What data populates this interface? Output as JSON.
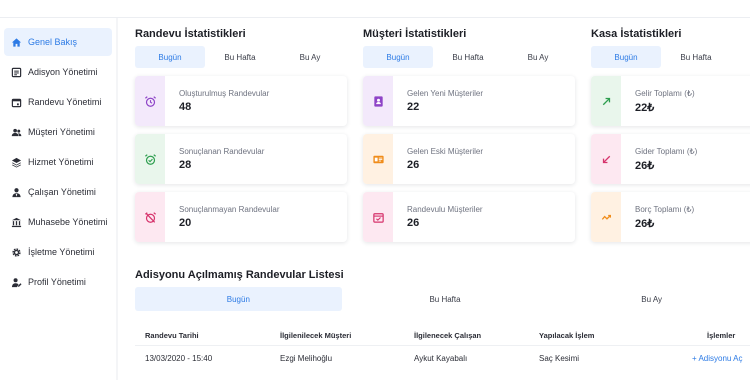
{
  "sidebar": {
    "items": [
      {
        "label": "Genel Bakış",
        "icon": "home-icon",
        "active": true
      },
      {
        "label": "Adisyon Yönetimi",
        "icon": "receipt-icon"
      },
      {
        "label": "Randevu Yönetimi",
        "icon": "calendar-icon"
      },
      {
        "label": "Müşteri Yönetimi",
        "icon": "users-icon"
      },
      {
        "label": "Hizmet Yönetimi",
        "icon": "layers-icon"
      },
      {
        "label": "Çalışan Yönetimi",
        "icon": "user-tie-icon"
      },
      {
        "label": "Muhasebe Yönetimi",
        "icon": "bank-icon"
      },
      {
        "label": "İşletme Yönetimi",
        "icon": "gear-icon"
      },
      {
        "label": "Profil Yönetimi",
        "icon": "profile-icon"
      }
    ]
  },
  "appointments": {
    "title": "Randevu İstatistikleri",
    "tabs": [
      "Bugün",
      "Bu Hafta",
      "Bu Ay"
    ],
    "cards": [
      {
        "label": "Oluşturulmuş Randevular",
        "value": "48"
      },
      {
        "label": "Sonuçlanan Randevular",
        "value": "28"
      },
      {
        "label": "Sonuçlanmayan Randevular",
        "value": "20"
      }
    ]
  },
  "customers": {
    "title": "Müşteri İstatistikleri",
    "tabs": [
      "Bugün",
      "Bu Hafta",
      "Bu Ay"
    ],
    "cards": [
      {
        "label": "Gelen Yeni Müşteriler",
        "value": "22"
      },
      {
        "label": "Gelen Eski Müşteriler",
        "value": "26"
      },
      {
        "label": "Randevulu Müşteriler",
        "value": "26"
      }
    ]
  },
  "cash": {
    "title": "Kasa İstatistikleri",
    "tabs": [
      "Bugün",
      "Bu Hafta"
    ],
    "cards": [
      {
        "label": "Gelir Toplamı (₺)",
        "value": "22₺"
      },
      {
        "label": "Gider Toplamı (₺)",
        "value": "26₺"
      },
      {
        "label": "Borç Toplamı (₺)",
        "value": "26₺"
      }
    ]
  },
  "unbilled": {
    "title": "Adisyonu Açılmamış Randevular Listesi",
    "tabs": [
      "Bugün",
      "Bu Hafta",
      "Bu Ay"
    ],
    "columns": [
      "Randevu Tarihi",
      "İlgilenilecek Müşteri",
      "İlgilenecek Çalışan",
      "Yapılacak İşlem",
      "İşlemler"
    ],
    "rows": [
      {
        "date": "13/03/2020 - 15:40",
        "customer": "Ezgi Melihoğlu",
        "employee": "Aykut Kayabalı",
        "service": "Saç Kesimi",
        "action": "+ Adisyonu Aç"
      }
    ]
  },
  "colors": {
    "accent": "#2d7be5",
    "purple_bg": "#f3e9fb",
    "purple": "#8e44c7",
    "green_bg": "#e9f6ec",
    "green": "#2e9e4f",
    "pink_bg": "#fde8f1",
    "pink": "#d6336c",
    "orange_bg": "#fff1e2",
    "orange": "#f08c1a"
  }
}
